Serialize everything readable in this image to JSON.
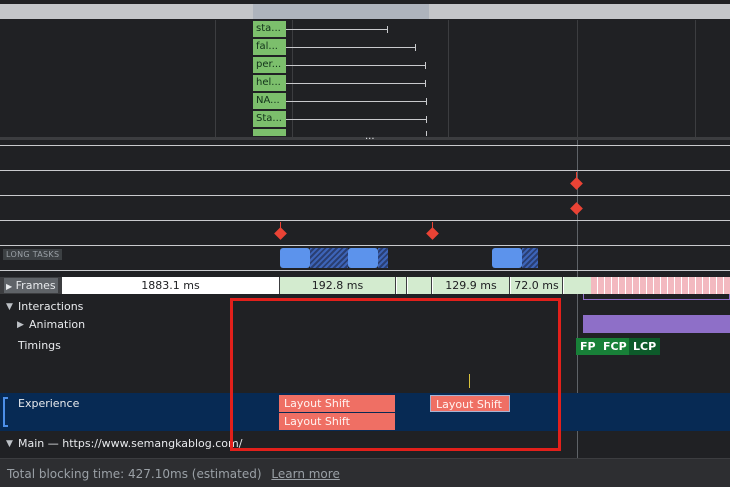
{
  "network": {
    "rows": [
      {
        "label": "sta...",
        "wait_end": 388
      },
      {
        "label": "fal...",
        "wait_end": 416
      },
      {
        "label": "per...",
        "wait_end": 426
      },
      {
        "label": "hel...",
        "wait_end": 426
      },
      {
        "label": "NA...",
        "wait_end": 427
      },
      {
        "label": "Sta...",
        "wait_end": 427
      },
      {
        "label": "",
        "wait_end": 427
      }
    ],
    "resize_handle": "..."
  },
  "long_tasks": {
    "label": "LONG TASKS"
  },
  "frames": {
    "label": "Frames",
    "segments": [
      "1883.1 ms",
      "192.8 ms",
      "129.9 ms",
      "72.0 ms"
    ]
  },
  "tracks": {
    "interactions": "Interactions",
    "animation": "Animation",
    "timings": "Timings",
    "experience": "Experience",
    "main": "Main — https://www.semangkablog.com/"
  },
  "timings": {
    "fp": "FP",
    "fcp": "FCP",
    "lcp": "LCP"
  },
  "experience": {
    "layout_shift": "Layout Shift"
  },
  "colors": {
    "background": "#202124",
    "experience_band": "#072a54",
    "layout_shift": "#ef6f64",
    "highlight_box": "#e2201b",
    "fp": "#188038",
    "fcp": "#188038",
    "lcp": "#0d5a2a",
    "animation": "#8e6fc8",
    "long_task": "#5c93ec",
    "frames_green": "#d3ebcf",
    "frames_pink": "#f3b9c0"
  },
  "footer": {
    "total_blocking": "Total blocking time: 427.10ms (estimated)",
    "learn_more": "Learn more"
  }
}
